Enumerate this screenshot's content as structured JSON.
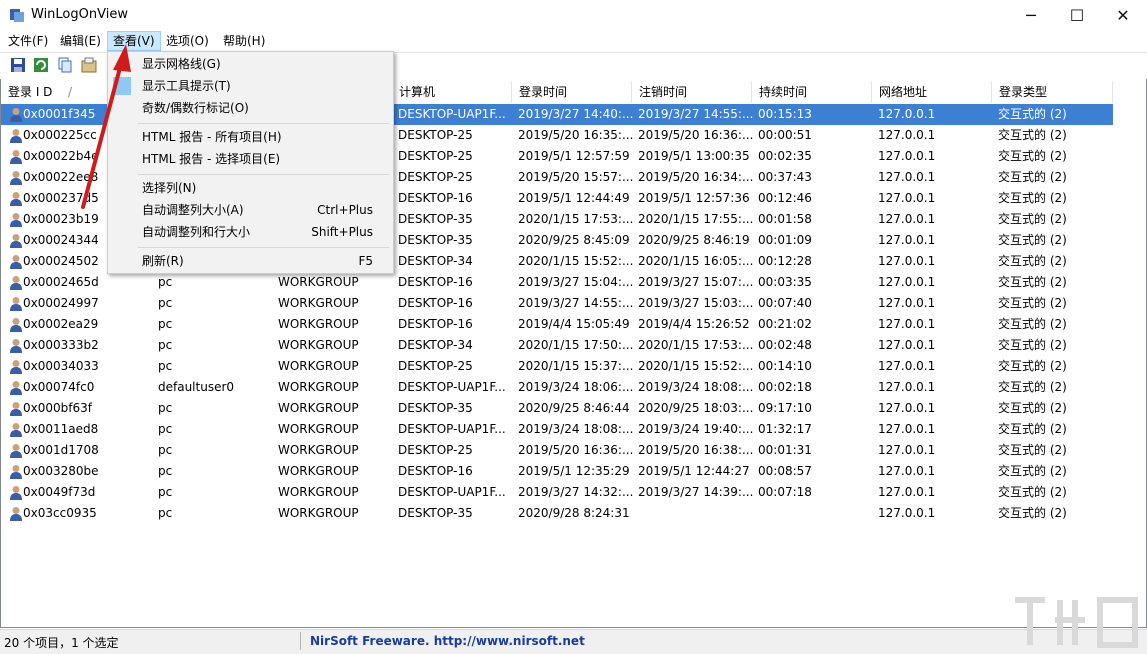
{
  "window": {
    "title": "WinLogOnView",
    "minimize": "─",
    "maximize": "☐",
    "close": "✕"
  },
  "menubar": [
    {
      "label": "文件(F)",
      "active": false
    },
    {
      "label": "编辑(E)",
      "active": false
    },
    {
      "label": "查看(V)",
      "active": true
    },
    {
      "label": "选项(O)",
      "active": false
    },
    {
      "label": "帮助(H)",
      "active": false
    }
  ],
  "view_menu": {
    "items": [
      {
        "label": "显示网格线(G)",
        "shortcut": "",
        "checked": false
      },
      {
        "label": "显示工具提示(T)",
        "shortcut": "",
        "checked": true
      },
      {
        "label": "奇数/偶数行标记(O)",
        "shortcut": "",
        "checked": false
      },
      {
        "label": "HTML 报告 - 所有项目(H)",
        "shortcut": ""
      },
      {
        "label": "HTML 报告 - 选择项目(E)",
        "shortcut": ""
      },
      {
        "label": "选择列(N)",
        "shortcut": ""
      },
      {
        "label": "自动调整列大小(A)",
        "shortcut": "Ctrl+Plus"
      },
      {
        "label": "自动调整列和行大小",
        "shortcut": "Shift+Plus"
      },
      {
        "label": "刷新(R)",
        "shortcut": "F5"
      }
    ]
  },
  "table": {
    "columns": [
      "登录 I D",
      "/",
      "计算机",
      "登录时间",
      "注销时间",
      "持续时间",
      "网络地址",
      "登录类型"
    ],
    "rows": [
      [
        "0x0001f345",
        "",
        "",
        "DESKTOP-UAP1F...",
        "2019/3/27 14:40:...",
        "2019/3/27 14:55:...",
        "00:15:13",
        "127.0.0.1",
        "交互式的 (2)"
      ],
      [
        "0x000225cc",
        "",
        "",
        "DESKTOP-25",
        "2019/5/20 16:35:...",
        "2019/5/20 16:36:...",
        "00:00:51",
        "127.0.0.1",
        "交互式的 (2)"
      ],
      [
        "0x00022b4e",
        "",
        "",
        "DESKTOP-25",
        "2019/5/1 12:57:59",
        "2019/5/1 13:00:35",
        "00:02:35",
        "127.0.0.1",
        "交互式的 (2)"
      ],
      [
        "0x00022ee8",
        "",
        "",
        "DESKTOP-25",
        "2019/5/20 15:57:...",
        "2019/5/20 16:34:...",
        "00:37:43",
        "127.0.0.1",
        "交互式的 (2)"
      ],
      [
        "0x000237d5",
        "",
        "",
        "DESKTOP-16",
        "2019/5/1 12:44:49",
        "2019/5/1 12:57:36",
        "00:12:46",
        "127.0.0.1",
        "交互式的 (2)"
      ],
      [
        "0x00023b19",
        "",
        "",
        "DESKTOP-35",
        "2020/1/15 17:53:...",
        "2020/1/15 17:55:...",
        "00:01:58",
        "127.0.0.1",
        "交互式的 (2)"
      ],
      [
        "0x00024344",
        "",
        "",
        "DESKTOP-35",
        "2020/9/25 8:45:09",
        "2020/9/25 8:46:19",
        "00:01:09",
        "127.0.0.1",
        "交互式的 (2)"
      ],
      [
        "0x00024502",
        "",
        "",
        "DESKTOP-34",
        "2020/1/15 15:52:...",
        "2020/1/15 16:05:...",
        "00:12:28",
        "127.0.0.1",
        "交互式的 (2)"
      ],
      [
        "0x0002465d",
        "pc",
        "WORKGROUP",
        "DESKTOP-16",
        "2019/3/27 15:04:...",
        "2019/3/27 15:07:...",
        "00:03:35",
        "127.0.0.1",
        "交互式的 (2)"
      ],
      [
        "0x00024997",
        "pc",
        "WORKGROUP",
        "DESKTOP-16",
        "2019/3/27 14:55:...",
        "2019/3/27 15:03:...",
        "00:07:40",
        "127.0.0.1",
        "交互式的 (2)"
      ],
      [
        "0x0002ea29",
        "pc",
        "WORKGROUP",
        "DESKTOP-16",
        "2019/4/4 15:05:49",
        "2019/4/4 15:26:52",
        "00:21:02",
        "127.0.0.1",
        "交互式的 (2)"
      ],
      [
        "0x000333b2",
        "pc",
        "WORKGROUP",
        "DESKTOP-34",
        "2020/1/15 17:50:...",
        "2020/1/15 17:53:...",
        "00:02:48",
        "127.0.0.1",
        "交互式的 (2)"
      ],
      [
        "0x00034033",
        "pc",
        "WORKGROUP",
        "DESKTOP-25",
        "2020/1/15 15:37:...",
        "2020/1/15 15:52:...",
        "00:14:10",
        "127.0.0.1",
        "交互式的 (2)"
      ],
      [
        "0x00074fc0",
        "defaultuser0",
        "WORKGROUP",
        "DESKTOP-UAP1F...",
        "2019/3/24 18:06:...",
        "2019/3/24 18:08:...",
        "00:02:18",
        "127.0.0.1",
        "交互式的 (2)"
      ],
      [
        "0x000bf63f",
        "pc",
        "WORKGROUP",
        "DESKTOP-35",
        "2020/9/25 8:46:44",
        "2020/9/25 18:03:...",
        "09:17:10",
        "127.0.0.1",
        "交互式的 (2)"
      ],
      [
        "0x0011aed8",
        "pc",
        "WORKGROUP",
        "DESKTOP-UAP1F...",
        "2019/3/24 18:08:...",
        "2019/3/24 19:40:...",
        "01:32:17",
        "127.0.0.1",
        "交互式的 (2)"
      ],
      [
        "0x001d1708",
        "pc",
        "WORKGROUP",
        "DESKTOP-25",
        "2019/5/20 16:36:...",
        "2019/5/20 16:38:...",
        "00:01:31",
        "127.0.0.1",
        "交互式的 (2)"
      ],
      [
        "0x003280be",
        "pc",
        "WORKGROUP",
        "DESKTOP-16",
        "2019/5/1 12:35:29",
        "2019/5/1 12:44:27",
        "00:08:57",
        "127.0.0.1",
        "交互式的 (2)"
      ],
      [
        "0x0049f73d",
        "pc",
        "WORKGROUP",
        "DESKTOP-UAP1F...",
        "2019/3/27 14:32:...",
        "2019/3/27 14:39:...",
        "00:07:18",
        "127.0.0.1",
        "交互式的 (2)"
      ],
      [
        "0x03cc0935",
        "pc",
        "WORKGROUP",
        "DESKTOP-35",
        "2020/9/28 8:24:31",
        "",
        "",
        "127.0.0.1",
        "交互式的 (2)"
      ]
    ],
    "selected_row": 0
  },
  "statusbar": {
    "count_text": "20 个项目，1 个选定",
    "credit_text": "NirSoft Freeware.  http://www.nirsoft.net"
  },
  "colors": {
    "selection": "#3d7fd3",
    "menu_highlight": "#cce8ff",
    "arrow": "#d11a1a"
  }
}
